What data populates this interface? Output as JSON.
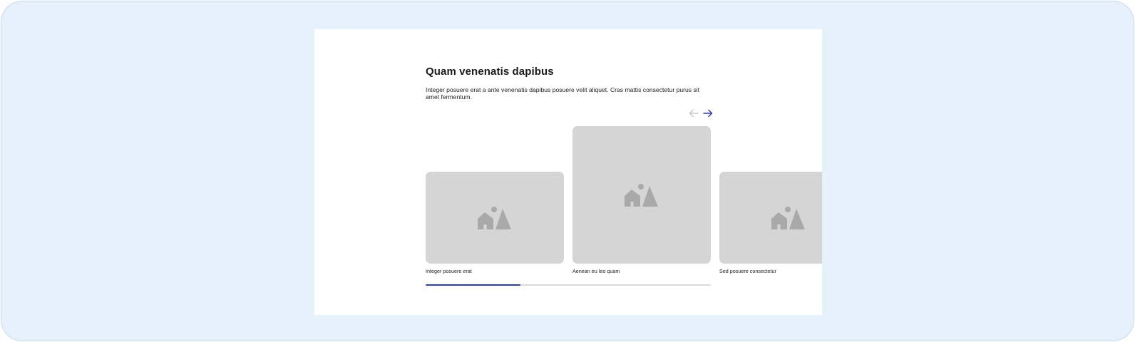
{
  "section": {
    "title": "Quam venenatis dapibus",
    "description": "Integer posuere erat a ante venenatis dapibus posuere velit aliquet. Cras mattis consectetur purus sit amet fermentum."
  },
  "carousel": {
    "prev_icon": "arrow-left-icon",
    "next_icon": "arrow-right-icon",
    "prev_color": "#c4c4c4",
    "next_color": "#2b3fb0",
    "slides": [
      {
        "caption": "Integer posuere erat",
        "icon": "image-placeholder-icon"
      },
      {
        "caption": "Aenean eu leo quam",
        "icon": "image-placeholder-icon"
      },
      {
        "caption": "Sed posuere consectetur",
        "icon": "image-placeholder-icon"
      }
    ],
    "progress": 0.333,
    "progress_color": "#2b3fb0",
    "track_color": "#d9d9d9"
  },
  "colors": {
    "frame_background": "#e7f1fb",
    "placeholder_fill": "#d5d5d5",
    "placeholder_icon": "#a9a9a9"
  }
}
